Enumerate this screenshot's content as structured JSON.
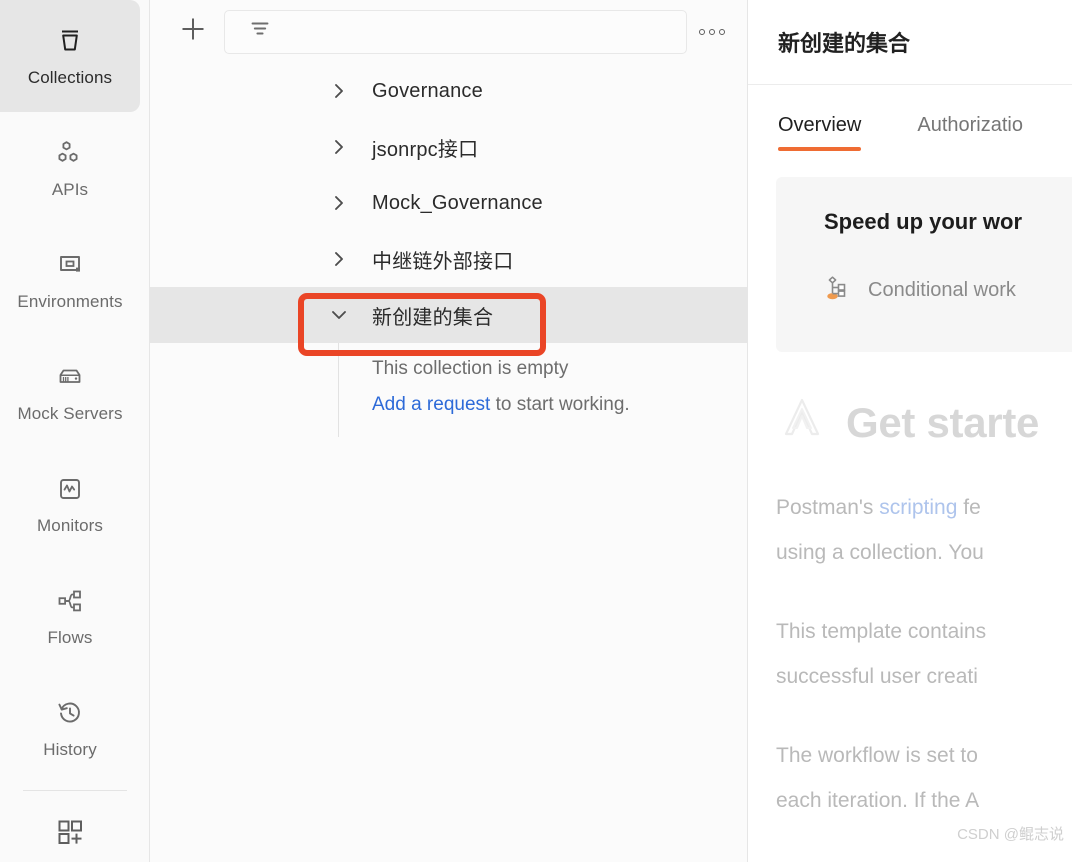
{
  "sidebar": {
    "items": [
      {
        "label": "Collections",
        "icon": "collections-icon",
        "active": true
      },
      {
        "label": "APIs",
        "icon": "apis-icon",
        "active": false
      },
      {
        "label": "Environments",
        "icon": "environments-icon",
        "active": false
      },
      {
        "label": "Mock Servers",
        "icon": "mock-servers-icon",
        "active": false
      },
      {
        "label": "Monitors",
        "icon": "monitors-icon",
        "active": false
      },
      {
        "label": "Flows",
        "icon": "flows-icon",
        "active": false
      },
      {
        "label": "History",
        "icon": "history-icon",
        "active": false
      }
    ],
    "bottom_icon": "add-module-icon"
  },
  "list_pane": {
    "new_button_icon": "plus-icon",
    "filter": {
      "icon": "filter-icon",
      "placeholder": ""
    },
    "more_icon": "more-options-icon",
    "collections": [
      {
        "name": "Governance",
        "expanded": false
      },
      {
        "name": "jsonrpc接口",
        "expanded": false
      },
      {
        "name": "Mock_Governance",
        "expanded": false
      },
      {
        "name": "中继链外部接口",
        "expanded": false
      },
      {
        "name": "新创建的集合",
        "expanded": true,
        "selected": true
      }
    ],
    "empty_state": {
      "line1": "This collection is empty",
      "link": "Add a request",
      "line2_rest": " to start working."
    }
  },
  "detail": {
    "title": "新创建的集合",
    "tabs": [
      {
        "label": "Overview",
        "active": true
      },
      {
        "label": "Authorizatio",
        "active": false
      }
    ],
    "promo": {
      "title": "Speed up your wor",
      "item_icon": "conditional-workflow-icon",
      "item_label": "Conditional work"
    },
    "doc": {
      "heading_icon": "postman-logo-icon",
      "heading": "Get starte",
      "paragraph1_a": "Postman's ",
      "paragraph1_link": "scripting",
      "paragraph1_b": " fe",
      "paragraph1_c": "using a collection. You",
      "paragraph2_a": "This template contains",
      "paragraph2_b": "successful user creati",
      "paragraph3_a": "The workflow is set to",
      "paragraph3_b": "each iteration. If the A"
    }
  },
  "watermark": "CSDN @鲲志说",
  "colors": {
    "accent_orange": "#ef6c33",
    "annotation_red": "#ea4526",
    "link_blue": "#2d6ad8",
    "selected_row": "#e6e6e6"
  }
}
